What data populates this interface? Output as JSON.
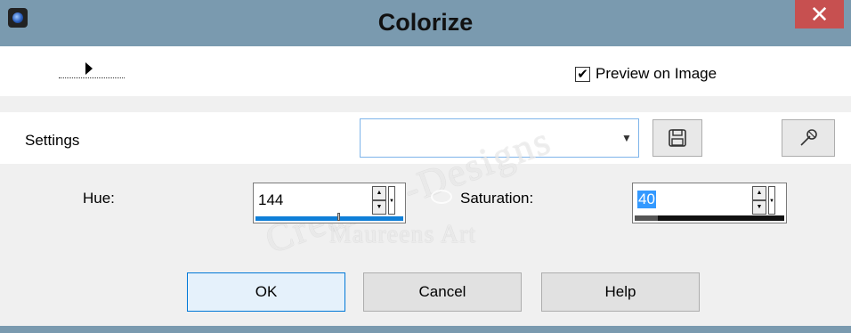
{
  "window": {
    "title": "Colorize",
    "close_label": "✕",
    "app_icon": "camera-lens-icon"
  },
  "preview": {
    "label": "Preview on Image",
    "checked": true,
    "check_glyph": "✔"
  },
  "settings": {
    "label": "Settings",
    "selected": "",
    "dropdown_glyph": "▼",
    "save_icon": "floppy-disk-icon",
    "reset_icon": "reset-settings-icon"
  },
  "hue": {
    "label": "Hue:",
    "value": "144",
    "max": 255
  },
  "saturation": {
    "label": "Saturation:",
    "value": "40",
    "max": 255
  },
  "buttons": {
    "ok": "OK",
    "cancel": "Cancel",
    "help": "Help"
  },
  "colors": {
    "titlebar": "#7a9aaf",
    "close": "#c75050",
    "accent": "#0f7fd8",
    "selection": "#3399ff"
  }
}
